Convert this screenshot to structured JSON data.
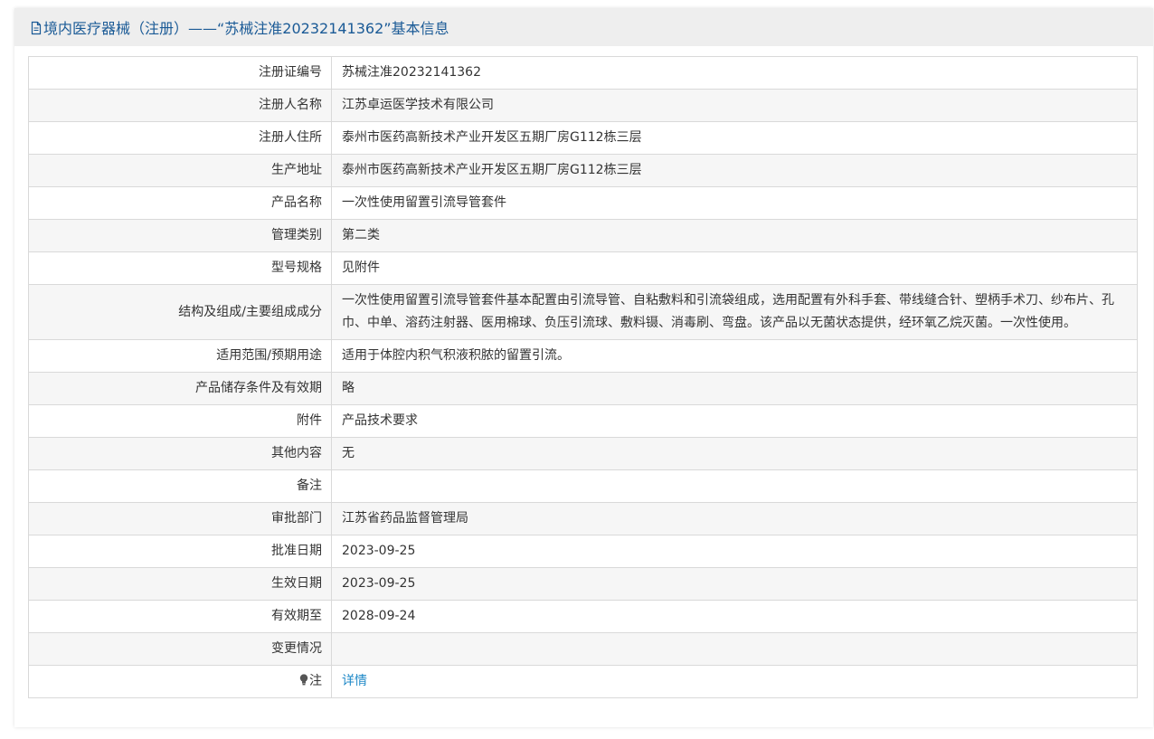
{
  "header": {
    "title": "境内医疗器械（注册）——“苏械注准20232141362”基本信息",
    "icon": "document-icon"
  },
  "rows": [
    {
      "label": "注册证编号",
      "value": "苏械注准20232141362"
    },
    {
      "label": "注册人名称",
      "value": "江苏卓运医学技术有限公司"
    },
    {
      "label": "注册人住所",
      "value": "泰州市医药高新技术产业开发区五期厂房G112栋三层"
    },
    {
      "label": "生产地址",
      "value": "泰州市医药高新技术产业开发区五期厂房G112栋三层"
    },
    {
      "label": "产品名称",
      "value": "一次性使用留置引流导管套件"
    },
    {
      "label": "管理类别",
      "value": "第二类"
    },
    {
      "label": "型号规格",
      "value": "见附件"
    },
    {
      "label": "结构及组成/主要组成成分",
      "value": "一次性使用留置引流导管套件基本配置由引流导管、自粘敷料和引流袋组成，选用配置有外科手套、带线缝合针、塑柄手术刀、纱布片、孔巾、中单、溶药注射器、医用棉球、负压引流球、敷料镊、消毒刷、弯盘。该产品以无菌状态提供，经环氧乙烷灭菌。一次性使用。"
    },
    {
      "label": "适用范围/预期用途",
      "value": "适用于体腔内积气积液积脓的留置引流。"
    },
    {
      "label": "产品储存条件及有效期",
      "value": "略"
    },
    {
      "label": "附件",
      "value": "产品技术要求"
    },
    {
      "label": "其他内容",
      "value": "无"
    },
    {
      "label": "备注",
      "value": ""
    },
    {
      "label": "审批部门",
      "value": "江苏省药品监督管理局"
    },
    {
      "label": "批准日期",
      "value": "2023-09-25"
    },
    {
      "label": "生效日期",
      "value": "2023-09-25"
    },
    {
      "label": "有效期至",
      "value": "2028-09-24"
    },
    {
      "label": "变更情况",
      "value": ""
    }
  ],
  "note": {
    "label": "注",
    "icon": "lightbulb-icon",
    "link_text": "详情"
  },
  "colors": {
    "title": "#1a5a96",
    "link": "#1e88c7",
    "header_bg": "#eeeeee",
    "row_alt_bg": "#f6f6f6",
    "border": "#d9d9d9"
  }
}
